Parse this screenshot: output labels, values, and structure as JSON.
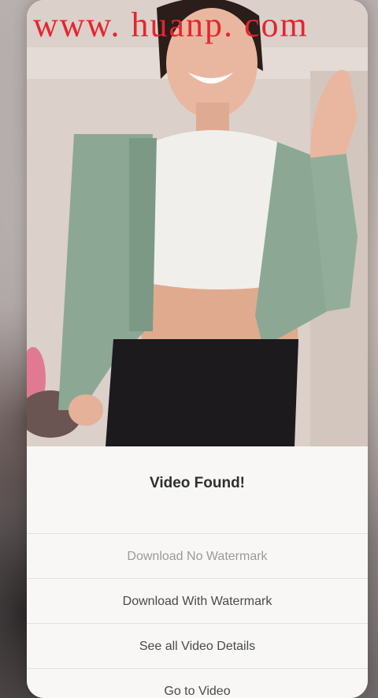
{
  "watermark": {
    "text": "www. huanp. com"
  },
  "video": {
    "description_icon": "video-thumbnail"
  },
  "sheet": {
    "title": "Video Found!",
    "options": [
      {
        "label": "Download No Watermark"
      },
      {
        "label": "Download With Watermark"
      },
      {
        "label": "See all Video Details"
      },
      {
        "label": "Go to Video"
      }
    ]
  },
  "colors": {
    "watermark": "#e6252f",
    "sheet_bg": "#f8f7f6",
    "divider": "#e3e1df"
  }
}
